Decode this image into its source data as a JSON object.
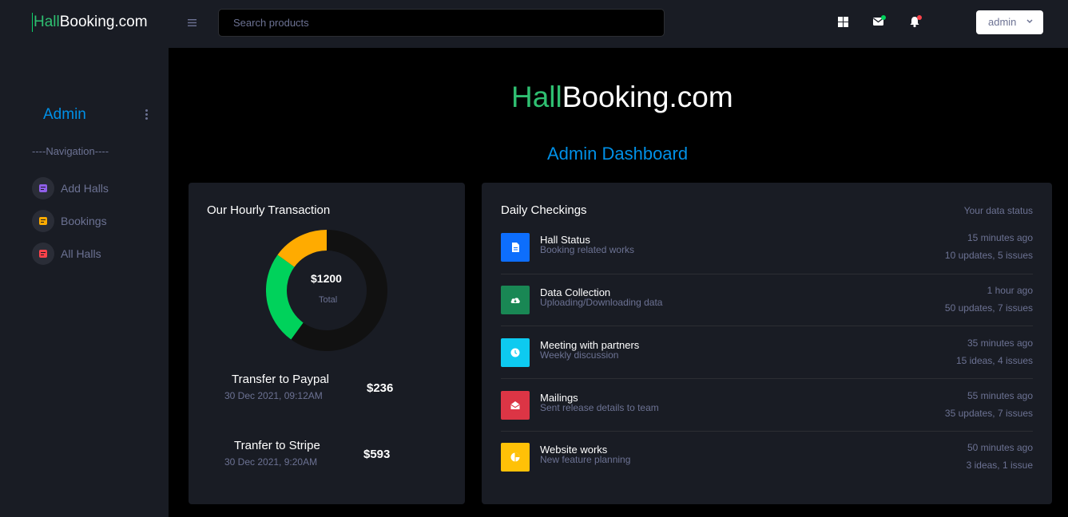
{
  "navbar": {
    "brand_hall": "Hall",
    "brand_rest": "Booking.com",
    "search_placeholder": "Search products",
    "user_label": "admin",
    "icons": [
      "menu-icon",
      "apps-icon",
      "mail-icon",
      "bell-icon",
      "chevron-down-icon"
    ]
  },
  "sidebar": {
    "profile_name": "Admin",
    "nav_heading": "----Navigation----",
    "items": [
      {
        "label": "Add Halls",
        "icon": "document-icon",
        "color": "#8f5fe8"
      },
      {
        "label": "Bookings",
        "icon": "document-icon",
        "color": "#ffab00"
      },
      {
        "label": "All Halls",
        "icon": "document-icon",
        "color": "#fc424a"
      }
    ]
  },
  "header": {
    "brand_hall": "Hall",
    "brand_rest": "Booking.com",
    "title": "Admin Dashboard"
  },
  "transactions_card": {
    "title": "Our Hourly Transaction",
    "donut_total": "$1200",
    "donut_label": "Total",
    "transactions": [
      {
        "title": "Transfer to Paypal",
        "date": "30 Dec 2021, 09:12AM",
        "amount": "$236"
      },
      {
        "title": "Tranfer to Stripe",
        "date": "30 Dec 2021, 9:20AM",
        "amount": "$593"
      }
    ]
  },
  "chart_data": {
    "type": "pie",
    "title": "",
    "categories": [
      "",
      "",
      ""
    ],
    "values": [
      60,
      25,
      15
    ],
    "colors": [
      "#111111",
      "#00d25b",
      "#ffab00"
    ],
    "center_text": "$1200",
    "center_subtext": "Total"
  },
  "checkings_card": {
    "title": "Daily Checkings",
    "status_label": "Your data status",
    "items": [
      {
        "title": "Hall Status",
        "subtitle": "Booking related works",
        "time": "15 minutes ago",
        "count": "10 updates, 5 issues",
        "icon": "file-icon",
        "color": "#0d6efd"
      },
      {
        "title": "Data Collection",
        "subtitle": "Uploading/Downloading data",
        "time": "1 hour ago",
        "count": "50 updates, 7 issues",
        "icon": "cloud-download-icon",
        "color": "#198754"
      },
      {
        "title": "Meeting with partners",
        "subtitle": "Weekly discussion",
        "time": "35 minutes ago",
        "count": "15 ideas, 4 issues",
        "icon": "clock-icon",
        "color": "#0dcaf0"
      },
      {
        "title": "Mailings",
        "subtitle": "Sent release details to team",
        "time": "55 minutes ago",
        "count": "35 updates, 7 issues",
        "icon": "mail-open-icon",
        "color": "#dc3545"
      },
      {
        "title": "Website works",
        "subtitle": "New feature planning",
        "time": "50 minutes ago",
        "count": "3 ideas, 1 issue",
        "icon": "pie-chart-icon",
        "color": "#ffc107"
      }
    ]
  }
}
